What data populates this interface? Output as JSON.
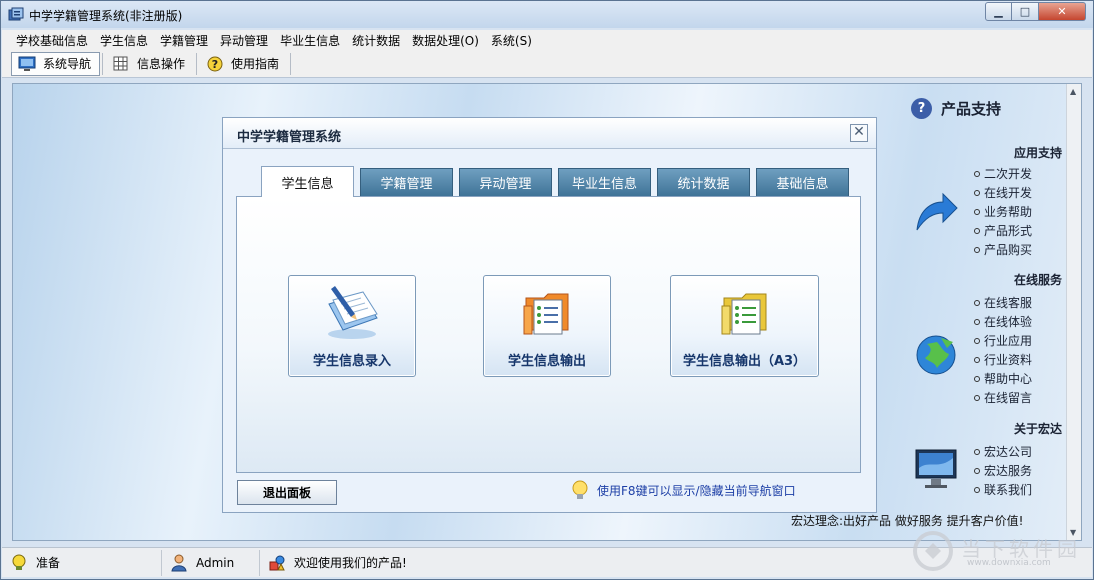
{
  "window": {
    "title": "中学学籍管理系统(非注册版)",
    "minimize": "▁",
    "maximize": "□",
    "close": "✕"
  },
  "menu": [
    "学校基础信息",
    "学生信息",
    "学籍管理",
    "异动管理",
    "毕业生信息",
    "统计数据",
    "数据处理(O)",
    "系统(S)"
  ],
  "toolbar": {
    "nav": "系统导航",
    "info_ops": "信息操作",
    "guide": "使用指南",
    "guide_icon": "?"
  },
  "panel": {
    "title": "中学学籍管理系统",
    "close": "✕",
    "tabs": [
      "学生信息",
      "学籍管理",
      "异动管理",
      "毕业生信息",
      "统计数据",
      "基础信息"
    ],
    "active_tab": 0,
    "actions": [
      "学生信息录入",
      "学生信息输出",
      "学生信息输出（A3）"
    ],
    "exit_button": "退出面板",
    "hint": "使用F8键可以显示/隐藏当前导航窗口"
  },
  "support": {
    "title": "产品支持",
    "title_icon": "?",
    "sections": [
      {
        "heading": "应用支持",
        "icon": "arrow-icon",
        "items": [
          "二次开发",
          "在线开发",
          "业务帮助",
          "产品形式",
          "产品购买"
        ]
      },
      {
        "heading": "在线服务",
        "icon": "globe-icon",
        "items": [
          "在线客服",
          "在线体验",
          "行业应用",
          "行业资料",
          "帮助中心",
          "在线留言"
        ]
      },
      {
        "heading": "关于宏达",
        "icon": "monitor-icon",
        "items": [
          "宏达公司",
          "宏达服务",
          "联系我们"
        ]
      }
    ],
    "motto": "宏达理念:出好产品 做好服务 提升客户价值!"
  },
  "status": {
    "ready": "准备",
    "user": "Admin",
    "welcome": "欢迎使用我们的产品!"
  },
  "watermark": {
    "text": "当下软件园",
    "url": "www.downxia.com"
  },
  "colors": {
    "tab_inactive": "#4f83a8",
    "action_label": "#16366b",
    "hint_text": "#1d3fa6"
  }
}
